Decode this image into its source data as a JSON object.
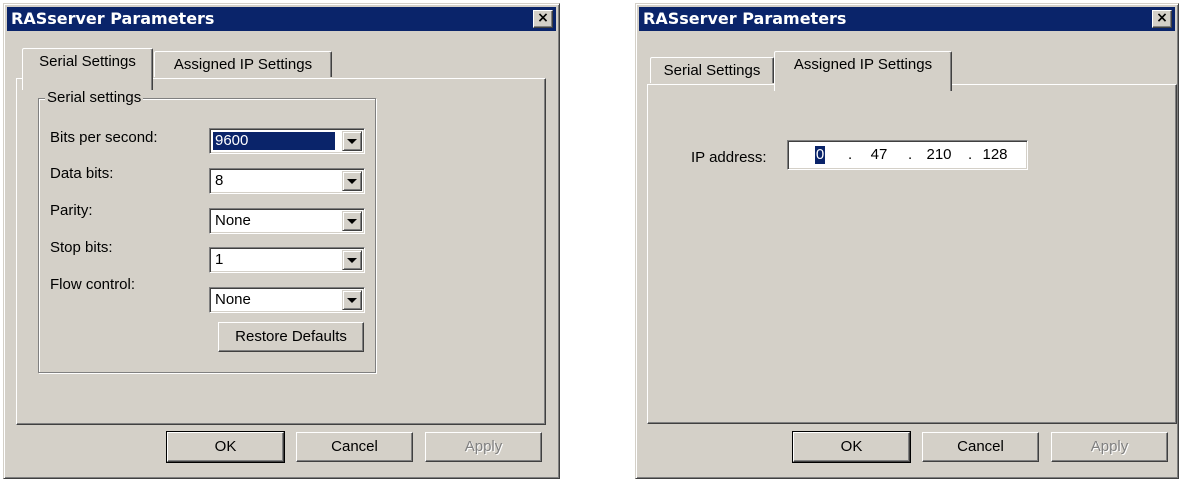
{
  "dialogs": [
    {
      "title": "RASserver Parameters",
      "close_label": "×",
      "tabs": [
        "Serial Settings",
        "Assigned IP Settings"
      ],
      "active_tab": "Serial Settings",
      "groupbox_label": "Serial settings",
      "fields": [
        {
          "label": "Bits per second:",
          "value": "9600"
        },
        {
          "label": "Data bits:",
          "value": "8"
        },
        {
          "label": "Parity:",
          "value": "None"
        },
        {
          "label": "Stop bits:",
          "value": "1"
        },
        {
          "label": "Flow control:",
          "value": "None"
        }
      ],
      "restore_defaults_label": "Restore Defaults",
      "buttons": {
        "ok": "OK",
        "cancel": "Cancel",
        "apply": "Apply"
      }
    },
    {
      "title": "RASserver Parameters",
      "close_label": "×",
      "tabs": [
        "Serial Settings",
        "Assigned IP Settings"
      ],
      "active_tab": "Assigned IP Settings",
      "ip_label": "IP address:",
      "ip_octets": [
        "0",
        "47",
        "210",
        "128"
      ],
      "ip_separator": ".",
      "buttons": {
        "ok": "OK",
        "cancel": "Cancel",
        "apply": "Apply"
      }
    }
  ]
}
